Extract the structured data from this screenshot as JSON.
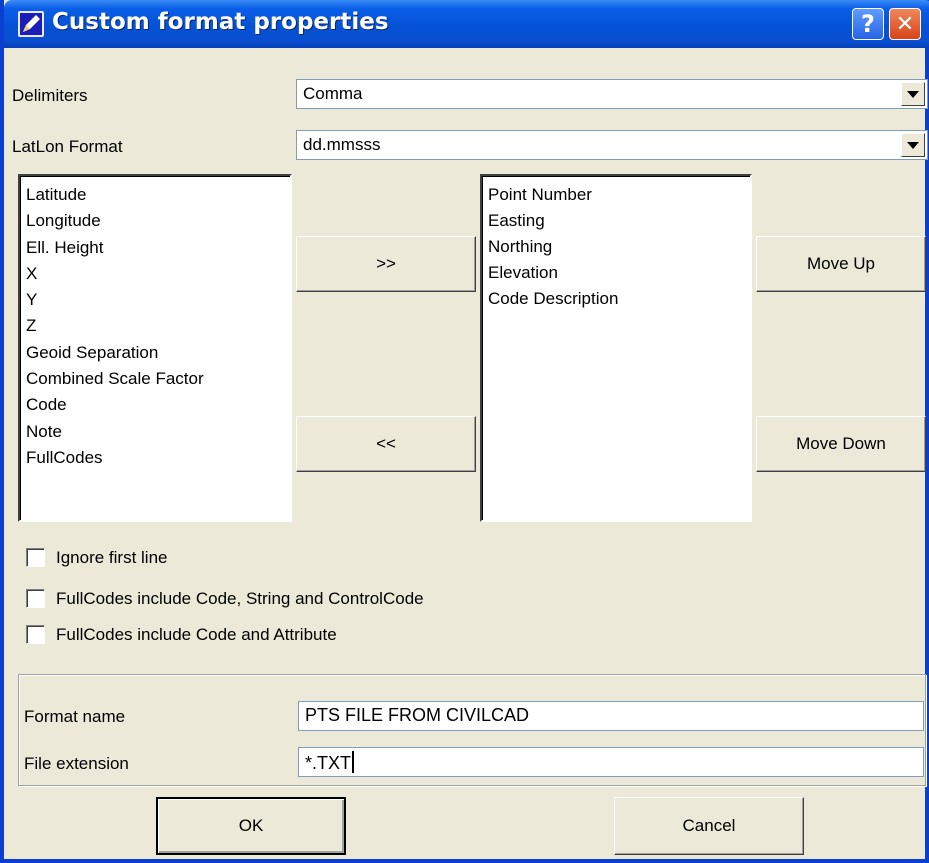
{
  "window": {
    "title": "Custom format properties",
    "help_label": "?",
    "close_label": "✕"
  },
  "delimiters": {
    "label": "Delimiters",
    "value": "Comma"
  },
  "latlon": {
    "label": "LatLon Format",
    "value": "dd.mmsss"
  },
  "available_fields": [
    "Latitude",
    "Longitude",
    "Ell. Height",
    "X",
    "Y",
    "Z",
    "Geoid Separation",
    "Combined Scale Factor",
    "Code",
    "Note",
    "FullCodes"
  ],
  "selected_fields": [
    "Point Number",
    "Easting",
    "Northing",
    "Elevation",
    "Code Description"
  ],
  "buttons": {
    "add": ">>",
    "remove": "<<",
    "move_up": "Move Up",
    "move_down": "Move Down",
    "ok": "OK",
    "cancel": "Cancel"
  },
  "options": [
    {
      "label": "Ignore first line",
      "checked": false
    },
    {
      "label": "FullCodes include Code, String and ControlCode",
      "checked": false
    },
    {
      "label": "FullCodes include Code and Attribute",
      "checked": false
    }
  ],
  "format_name": {
    "label": "Format name",
    "value": "PTS FILE FROM CIVILCAD"
  },
  "file_extension": {
    "label": "File extension",
    "value": "*.TXT"
  },
  "icons": {
    "title": "pencil-app-icon",
    "dropdown": "chevron-down-icon"
  }
}
